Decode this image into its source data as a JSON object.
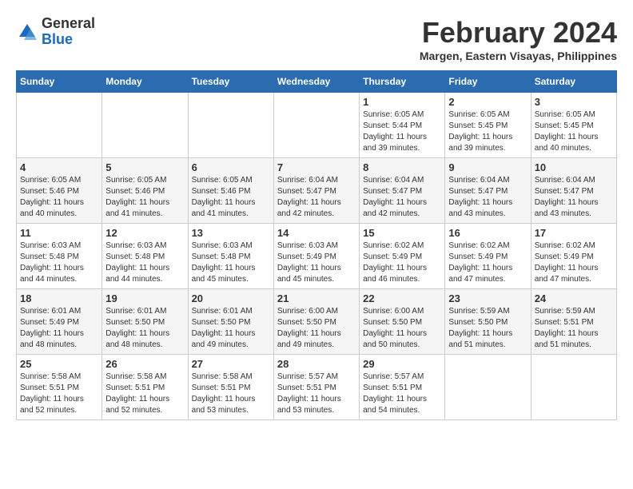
{
  "header": {
    "logo_general": "General",
    "logo_blue": "Blue",
    "title": "February 2024",
    "location": "Margen, Eastern Visayas, Philippines"
  },
  "days_of_week": [
    "Sunday",
    "Monday",
    "Tuesday",
    "Wednesday",
    "Thursday",
    "Friday",
    "Saturday"
  ],
  "weeks": [
    [
      {
        "day": "",
        "info": ""
      },
      {
        "day": "",
        "info": ""
      },
      {
        "day": "",
        "info": ""
      },
      {
        "day": "",
        "info": ""
      },
      {
        "day": "1",
        "info": "Sunrise: 6:05 AM\nSunset: 5:44 PM\nDaylight: 11 hours and 39 minutes."
      },
      {
        "day": "2",
        "info": "Sunrise: 6:05 AM\nSunset: 5:45 PM\nDaylight: 11 hours and 39 minutes."
      },
      {
        "day": "3",
        "info": "Sunrise: 6:05 AM\nSunset: 5:45 PM\nDaylight: 11 hours and 40 minutes."
      }
    ],
    [
      {
        "day": "4",
        "info": "Sunrise: 6:05 AM\nSunset: 5:46 PM\nDaylight: 11 hours and 40 minutes."
      },
      {
        "day": "5",
        "info": "Sunrise: 6:05 AM\nSunset: 5:46 PM\nDaylight: 11 hours and 41 minutes."
      },
      {
        "day": "6",
        "info": "Sunrise: 6:05 AM\nSunset: 5:46 PM\nDaylight: 11 hours and 41 minutes."
      },
      {
        "day": "7",
        "info": "Sunrise: 6:04 AM\nSunset: 5:47 PM\nDaylight: 11 hours and 42 minutes."
      },
      {
        "day": "8",
        "info": "Sunrise: 6:04 AM\nSunset: 5:47 PM\nDaylight: 11 hours and 42 minutes."
      },
      {
        "day": "9",
        "info": "Sunrise: 6:04 AM\nSunset: 5:47 PM\nDaylight: 11 hours and 43 minutes."
      },
      {
        "day": "10",
        "info": "Sunrise: 6:04 AM\nSunset: 5:47 PM\nDaylight: 11 hours and 43 minutes."
      }
    ],
    [
      {
        "day": "11",
        "info": "Sunrise: 6:03 AM\nSunset: 5:48 PM\nDaylight: 11 hours and 44 minutes."
      },
      {
        "day": "12",
        "info": "Sunrise: 6:03 AM\nSunset: 5:48 PM\nDaylight: 11 hours and 44 minutes."
      },
      {
        "day": "13",
        "info": "Sunrise: 6:03 AM\nSunset: 5:48 PM\nDaylight: 11 hours and 45 minutes."
      },
      {
        "day": "14",
        "info": "Sunrise: 6:03 AM\nSunset: 5:49 PM\nDaylight: 11 hours and 45 minutes."
      },
      {
        "day": "15",
        "info": "Sunrise: 6:02 AM\nSunset: 5:49 PM\nDaylight: 11 hours and 46 minutes."
      },
      {
        "day": "16",
        "info": "Sunrise: 6:02 AM\nSunset: 5:49 PM\nDaylight: 11 hours and 47 minutes."
      },
      {
        "day": "17",
        "info": "Sunrise: 6:02 AM\nSunset: 5:49 PM\nDaylight: 11 hours and 47 minutes."
      }
    ],
    [
      {
        "day": "18",
        "info": "Sunrise: 6:01 AM\nSunset: 5:49 PM\nDaylight: 11 hours and 48 minutes."
      },
      {
        "day": "19",
        "info": "Sunrise: 6:01 AM\nSunset: 5:50 PM\nDaylight: 11 hours and 48 minutes."
      },
      {
        "day": "20",
        "info": "Sunrise: 6:01 AM\nSunset: 5:50 PM\nDaylight: 11 hours and 49 minutes."
      },
      {
        "day": "21",
        "info": "Sunrise: 6:00 AM\nSunset: 5:50 PM\nDaylight: 11 hours and 49 minutes."
      },
      {
        "day": "22",
        "info": "Sunrise: 6:00 AM\nSunset: 5:50 PM\nDaylight: 11 hours and 50 minutes."
      },
      {
        "day": "23",
        "info": "Sunrise: 5:59 AM\nSunset: 5:50 PM\nDaylight: 11 hours and 51 minutes."
      },
      {
        "day": "24",
        "info": "Sunrise: 5:59 AM\nSunset: 5:51 PM\nDaylight: 11 hours and 51 minutes."
      }
    ],
    [
      {
        "day": "25",
        "info": "Sunrise: 5:58 AM\nSunset: 5:51 PM\nDaylight: 11 hours and 52 minutes."
      },
      {
        "day": "26",
        "info": "Sunrise: 5:58 AM\nSunset: 5:51 PM\nDaylight: 11 hours and 52 minutes."
      },
      {
        "day": "27",
        "info": "Sunrise: 5:58 AM\nSunset: 5:51 PM\nDaylight: 11 hours and 53 minutes."
      },
      {
        "day": "28",
        "info": "Sunrise: 5:57 AM\nSunset: 5:51 PM\nDaylight: 11 hours and 53 minutes."
      },
      {
        "day": "29",
        "info": "Sunrise: 5:57 AM\nSunset: 5:51 PM\nDaylight: 11 hours and 54 minutes."
      },
      {
        "day": "",
        "info": ""
      },
      {
        "day": "",
        "info": ""
      }
    ]
  ]
}
